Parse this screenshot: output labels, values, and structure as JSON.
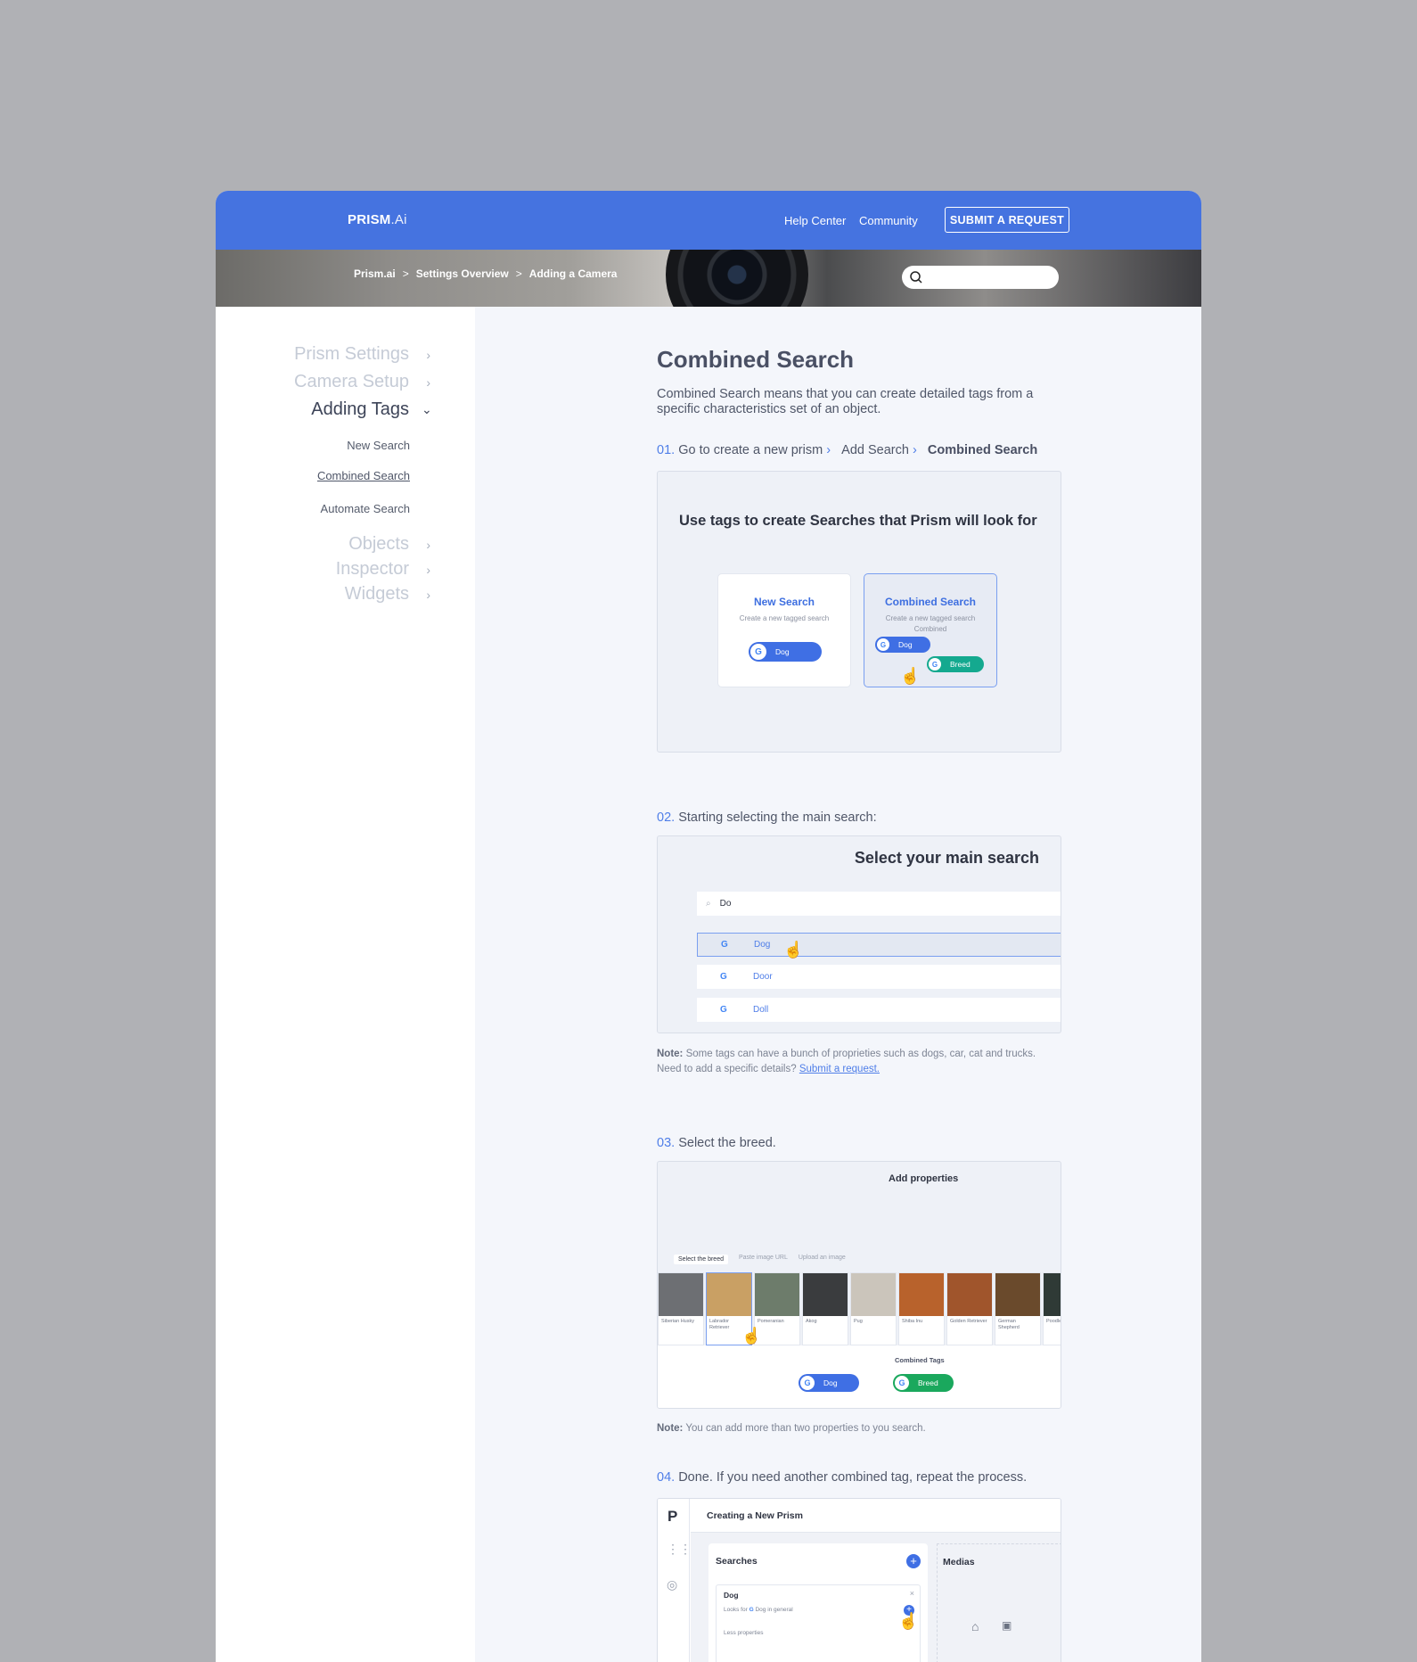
{
  "brand": {
    "name_bold": "PRISM",
    "name_light": ".Ai"
  },
  "topnav": {
    "help_center": "Help Center",
    "community": "Community",
    "submit": "SUBMIT A REQUEST"
  },
  "breadcrumb": {
    "items": [
      "Prism.ai",
      "Settings Overview",
      "Adding a Camera"
    ],
    "sep": ">"
  },
  "sidebar": {
    "items": [
      {
        "label": "Prism Settings"
      },
      {
        "label": "Camera Setup"
      },
      {
        "label": "Adding Tags"
      },
      {
        "label": "Objects"
      },
      {
        "label": "Inspector"
      },
      {
        "label": "Widgets"
      }
    ],
    "sub_items": [
      {
        "label": "New Search"
      },
      {
        "label": "Combined Search"
      },
      {
        "label": "Automate Search"
      }
    ]
  },
  "article": {
    "title": "Combined Search",
    "intro": "Combined Search means that you can create detailed tags from a specific characteristics set of an object.",
    "step1": {
      "num": "01.",
      "text": "Go to create a new prism",
      "part2": "Add Search",
      "part3": "Combined Search"
    },
    "panel1": {
      "title": "Use tags to create Searches that Prism will look for",
      "card1": {
        "title": "New Search",
        "sub": "Create a new tagged search",
        "pill": "Dog"
      },
      "card2": {
        "title": "Combined Search",
        "sub": "Create a new tagged search",
        "sub2": "Combined",
        "pill1": "Dog",
        "pill2": "Breed"
      }
    },
    "step2": {
      "num": "02.",
      "text": "Starting selecting the main search:"
    },
    "panel2": {
      "title": "Select your main search",
      "query": "Do",
      "results": [
        "Dog",
        "Door",
        "Doll"
      ]
    },
    "note1": {
      "label": "Note:",
      "text": "Some tags can have a bunch of proprieties such as dogs, car, cat and trucks.",
      "line2": "Need to add a specific details?",
      "link": "Submit a request."
    },
    "step3": {
      "num": "03.",
      "text": "Select the breed."
    },
    "panel3": {
      "title": "Add properties",
      "tabs": [
        "Select the breed",
        "Paste image URL",
        "Upload an image"
      ],
      "breeds": [
        "Siberian Husky",
        "Labrador Retriever",
        "Pomeranian",
        "Akog",
        "Pug",
        "Shiba Inu",
        "Golden Retriever",
        "German Shepherd",
        "Poodle"
      ],
      "combined_label": "Combined Tags",
      "pill1": "Dog",
      "pill2": "Breed"
    },
    "note2": {
      "label": "Note:",
      "text": "You can add more than two properties to you search."
    },
    "step4": {
      "num": "04.",
      "text": "Done. If you need another combined tag, repeat the process."
    },
    "panel4": {
      "header": "Creating a New Prism",
      "searches": "Searches",
      "medias": "Medias",
      "item_title": "Dog",
      "item_looks_label": "Looks for",
      "item_looks_value": "Dog",
      "item_looks_suffix": "in general",
      "item_less": "Less properties"
    }
  },
  "colors": {
    "brand": "#4573e0",
    "accent": "#4f7ee8",
    "green": "#14a98f"
  }
}
